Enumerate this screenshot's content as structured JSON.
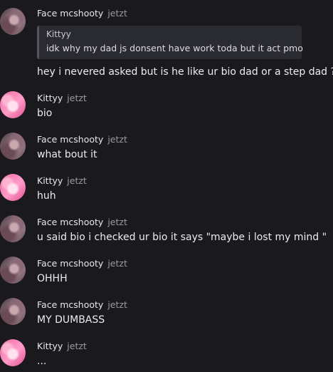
{
  "messages": [
    {
      "author": "Face mcshooty",
      "time": "jetzt",
      "avatar": "face-avatar",
      "reply": {
        "author": "Kittyy",
        "text": "idk why my dad js donsent have work toda but it act pmo"
      },
      "text": "hey i nevered asked but is he like ur bio dad or a step dad ?"
    },
    {
      "author": "Kittyy",
      "time": "jetzt",
      "avatar": "kitty-avatar",
      "text": "bio"
    },
    {
      "author": "Face mcshooty",
      "time": "jetzt",
      "avatar": "face-avatar",
      "text": "what bout it"
    },
    {
      "author": "Kittyy",
      "time": "jetzt",
      "avatar": "kitty-avatar",
      "text": "huh"
    },
    {
      "author": "Face mcshooty",
      "time": "jetzt",
      "avatar": "face-avatar",
      "text": "u said bio i checked ur bio it says \"maybe i lost my mind \""
    },
    {
      "author": "Face mcshooty",
      "time": "jetzt",
      "avatar": "face-avatar",
      "text": "OHHH"
    },
    {
      "author": "Face mcshooty",
      "time": "jetzt",
      "avatar": "face-avatar",
      "text": "MY DUMBASS"
    },
    {
      "author": "Kittyy",
      "time": "jetzt",
      "avatar": "kitty-avatar",
      "text": "..."
    }
  ],
  "colors": {
    "background": "#1a1a1e",
    "quote_background": "#2a2a31",
    "timestamp": "#9a9aa2"
  }
}
